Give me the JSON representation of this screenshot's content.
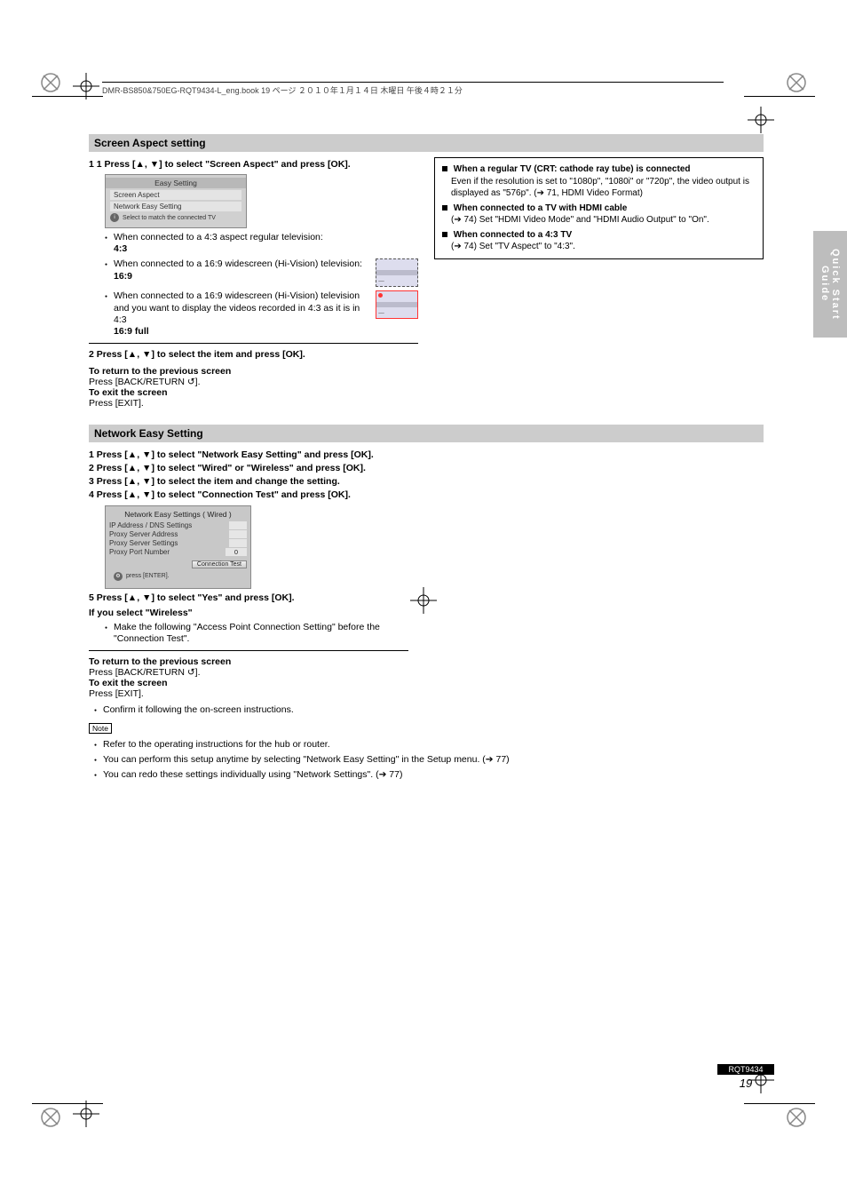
{
  "header_filepath": "DMR-BS850&750EG-RQT9434-L_eng.book  19 ページ  ２０１０年１月１４日  木曜日  午後４時２１分",
  "side_tab": "Quick Start Guide",
  "section1": {
    "bar": "Screen Aspect setting",
    "step1": "1 Press [▲, ▼] to select \"Screen Aspect\" and press [OK].",
    "menu_title": "Easy Setting",
    "menu_items": [
      "Screen Aspect",
      "Network Easy Setting"
    ],
    "menu_caption": "Select to match the connected TV",
    "bullets": [
      "When connected to a 4:3 aspect regular television:",
      "When connected to a 16:9 widescreen (Hi-Vision) television:",
      "When connected to a 16:9 widescreen (Hi-Vision) television and you want to display the videos recorded in 4:3 as it is in 4:3"
    ],
    "values": [
      "4:3",
      "16:9",
      "16:9 full"
    ],
    "step2_a": "2 Press [▲, ▼] to select the item and press [OK].",
    "box": {
      "line1_lead": "When a regular TV (CRT: cathode ray tube) is connected",
      "line1_body": "Even if the resolution is set to \"1080p\", \"1080i\" or \"720p\", the video output is displayed as \"576p\". (➔ 71, HDMI Video Format)",
      "line2_lead": "When connected to a TV with HDMI cable",
      "line2_body": "(➔ 74) Set \"HDMI Video Mode\" and \"HDMI Audio Output\" to \"On\".",
      "line3_lead": "When connected to a 4:3 TV",
      "line3_body": "(➔ 74) Set \"TV Aspect\" to \"4:3\"."
    },
    "exit_prev": "To return to the previous screen",
    "exit_prev2": "Press [BACK/RETURN ↺].",
    "exit_main": "To exit the screen",
    "exit_main2": "Press [EXIT]."
  },
  "section2": {
    "bar": "Network Easy Setting",
    "step1": [
      "1 Press [▲, ▼] to select \"Network Easy Setting\" and press [OK].",
      "2 Press [▲, ▼] to select \"Wired\" or \"Wireless\" and press [OK].",
      "3 Press [▲, ▼] to select the item and change the setting.",
      "4 Press [▲, ▼] to select \"Connection Test\" and press [OK]."
    ],
    "box_title": "Network Easy Settings ( Wired )",
    "rows": [
      {
        "lab": "IP Address / DNS Settings",
        "val": ""
      },
      {
        "lab": "Proxy Server Address",
        "val": ""
      },
      {
        "lab": "Proxy Server Settings",
        "val": ""
      },
      {
        "lab": "Proxy Port Number",
        "val": "0"
      }
    ],
    "conn_test": "Connection Test",
    "press_enter": "press [ENTER].",
    "step5": "5 Press [▲, ▼] to select \"Yes\" and press [OK].",
    "wireless_line": "If you select \"Wireless\"",
    "wireless_body": "Make the following \"Access Point Connection Setting\" before the \"Connection Test\".",
    "exit_prev": "To return to the previous screen",
    "exit_prev2": "Press [BACK/RETURN ↺].",
    "exit_main": "To exit the screen",
    "exit_main2": "Press [EXIT].",
    "confirm": "Confirm it following the on-screen instructions.",
    "note_label": "Note",
    "notes": [
      "Refer to the operating instructions for the hub or router.",
      "You can perform this setup anytime by selecting \"Network Easy Setting\" in the Setup menu. (➔ 77)",
      "You can redo these settings individually using \"Network Settings\". (➔ 77)"
    ]
  },
  "footer": {
    "code": "RQT9434",
    "page": "19"
  }
}
